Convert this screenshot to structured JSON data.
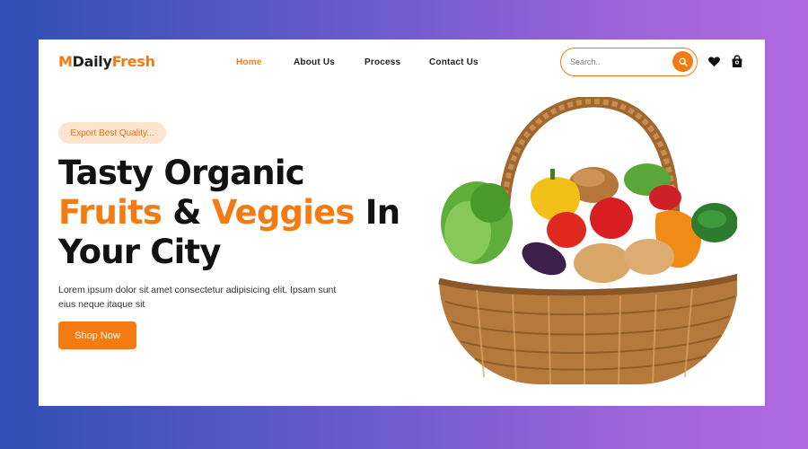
{
  "brand": {
    "part1": "M",
    "part2": "Daily",
    "part3": "Fresh"
  },
  "nav": {
    "items": [
      {
        "label": "Home",
        "active": true
      },
      {
        "label": "About Us",
        "active": false
      },
      {
        "label": "Process",
        "active": false
      },
      {
        "label": "Contact Us",
        "active": false
      }
    ]
  },
  "search": {
    "placeholder": "Search..",
    "icon": "search-icon"
  },
  "header_icons": [
    "heart-icon",
    "shopping-bag-icon"
  ],
  "hero": {
    "badge": "Export Best Quality...",
    "title_line1": "Tasty Organic",
    "title_line2_a": "Fruits",
    "title_line2_b": "&",
    "title_line2_c": "Veggies",
    "title_line2_d": "In",
    "title_line3": "Your City",
    "description": "Lorem ipsum dolor sit amet consectetur adipisicing elit. Ipsam sunt eius neque itaque sit",
    "cta_label": "Shop Now"
  },
  "colors": {
    "accent": "#f47b12",
    "badge_bg": "#fde4cf",
    "text": "#111111",
    "background_gradient": [
      "#2f4fb5",
      "#b169e0"
    ]
  }
}
